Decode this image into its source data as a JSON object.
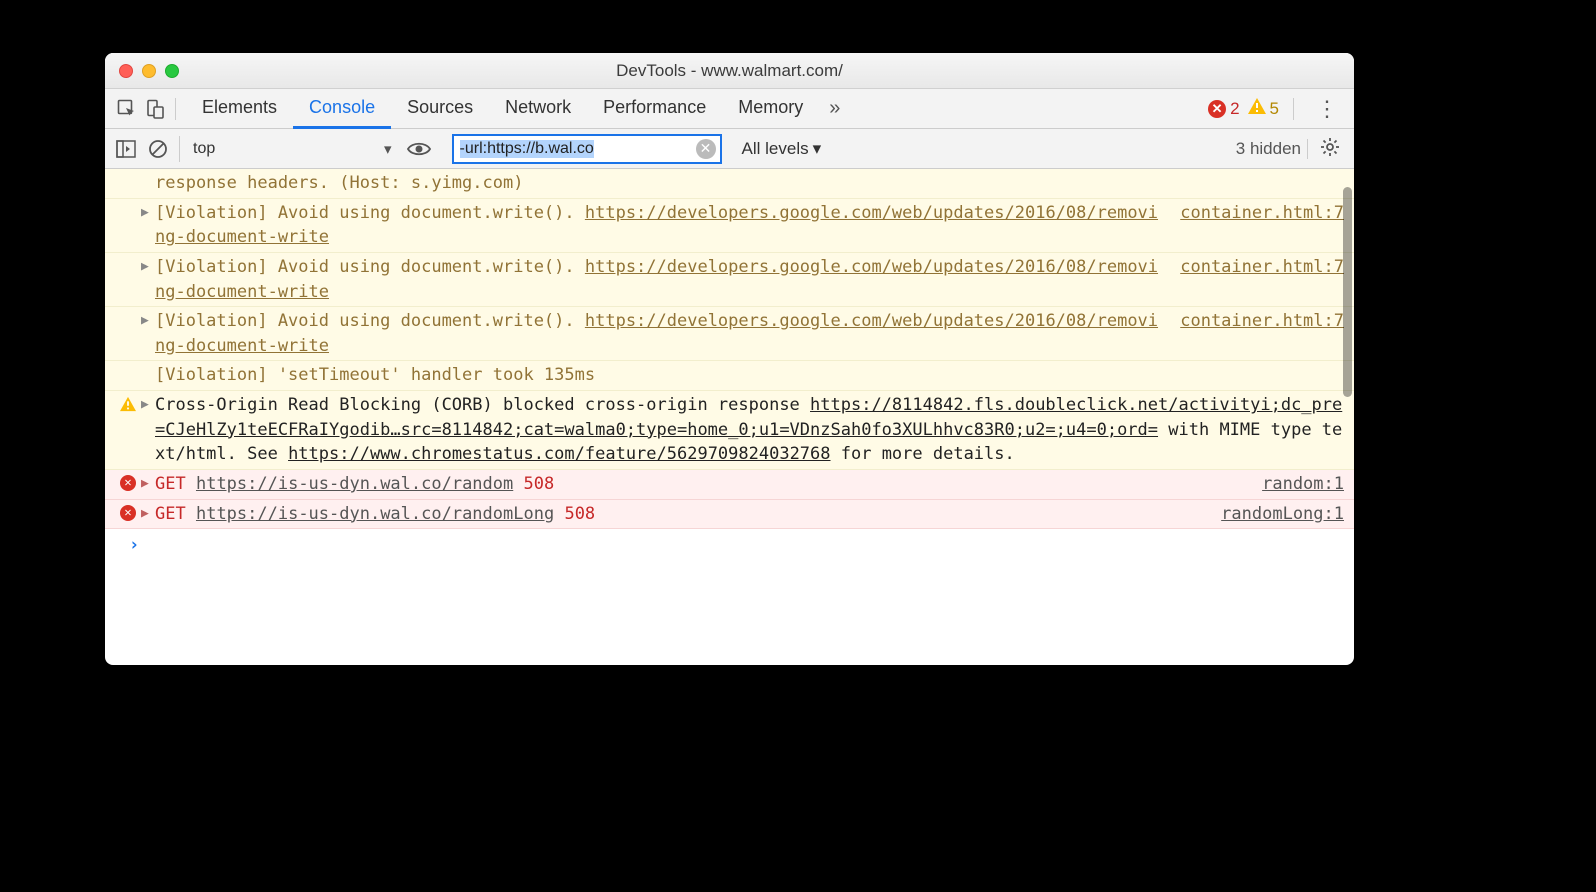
{
  "window": {
    "title": "DevTools - www.walmart.com/"
  },
  "tabs": {
    "items": [
      "Elements",
      "Console",
      "Sources",
      "Network",
      "Performance",
      "Memory"
    ],
    "active_index": 1,
    "more_glyph": "»",
    "errors_count": "2",
    "warnings_count": "5"
  },
  "filterbar": {
    "context": "top",
    "filter_value": "-url:https://b.wal.co",
    "levels_label": "All levels",
    "hidden_label": "3 hidden"
  },
  "messages": [
    {
      "type": "verbose",
      "expandable": false,
      "text": "response headers. (Host: s.yimg.com)",
      "source": ""
    },
    {
      "type": "verbose",
      "expandable": true,
      "text": "[Violation] Avoid using document.write(). ",
      "link": "https://developers.google.com/web/updates/2016/08/removing-document-write",
      "source": "container.html:7"
    },
    {
      "type": "verbose",
      "expandable": true,
      "text": "[Violation] Avoid using document.write(). ",
      "link": "https://developers.google.com/web/updates/2016/08/removing-document-write",
      "source": "container.html:7"
    },
    {
      "type": "verbose",
      "expandable": true,
      "text": "[Violation] Avoid using document.write(). ",
      "link": "https://developers.google.com/web/updates/2016/08/removing-document-write",
      "source": "container.html:7"
    },
    {
      "type": "verbose",
      "expandable": false,
      "text": "[Violation] 'setTimeout' handler took 135ms",
      "source": ""
    },
    {
      "type": "warn",
      "expandable": true,
      "pre": "Cross-Origin Read Blocking (CORB) blocked cross-origin response ",
      "link1": "https://8114842.fls.doubleclick.net/activityi;dc_pre=CJeHlZy1teECFRaIYgodib…src=8114842;cat=walma0;type=home_0;u1=VDnzSah0fo3XULhhvc83R0;u2=;u4=0;ord=",
      "mid": " with MIME type text/html. See ",
      "link2": "https://www.chromestatus.com/feature/5629709824032768",
      "post": " for more details.",
      "source": ""
    },
    {
      "type": "err",
      "expandable": true,
      "method": "GET",
      "url": "https://is-us-dyn.wal.co/random",
      "code": "508",
      "source": "random:1"
    },
    {
      "type": "err",
      "expandable": true,
      "method": "GET",
      "url": "https://is-us-dyn.wal.co/randomLong",
      "code": "508",
      "source": "randomLong:1"
    }
  ]
}
